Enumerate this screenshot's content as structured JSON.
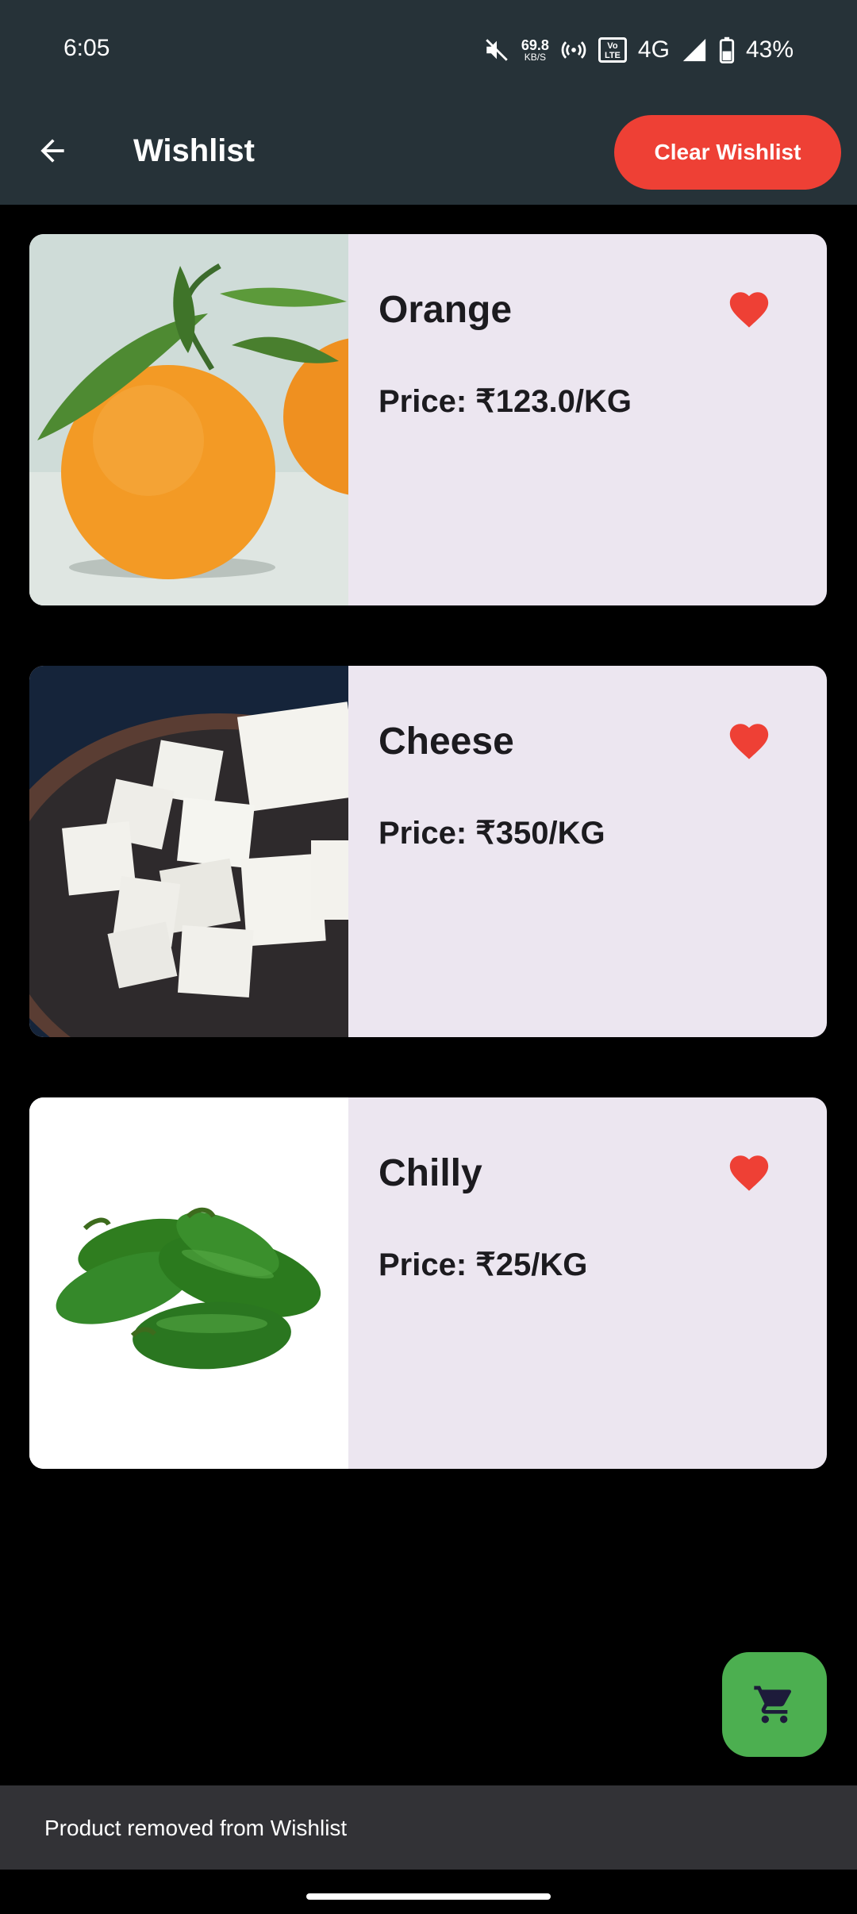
{
  "status": {
    "time": "6:05",
    "speed_value": "69.8",
    "speed_unit": "KB/S",
    "volte": "Vo LTE",
    "network": "4G",
    "battery": "43%"
  },
  "appbar": {
    "title": "Wishlist",
    "clear_label": "Clear Wishlist"
  },
  "items": [
    {
      "name": "Orange",
      "price": "Price: ₹123.0/KG"
    },
    {
      "name": "Cheese",
      "price": "Price: ₹350/KG"
    },
    {
      "name": "Chilly",
      "price": "Price: ₹25/KG"
    }
  ],
  "snackbar": {
    "message": "Product removed from Wishlist"
  },
  "colors": {
    "appbar": "#263238",
    "clear_button": "#ee4035",
    "card": "#ece6f0",
    "heart": "#ee4035",
    "fab": "#4caf50"
  },
  "icons": [
    "back-arrow-icon",
    "heart-icon",
    "cart-icon"
  ]
}
